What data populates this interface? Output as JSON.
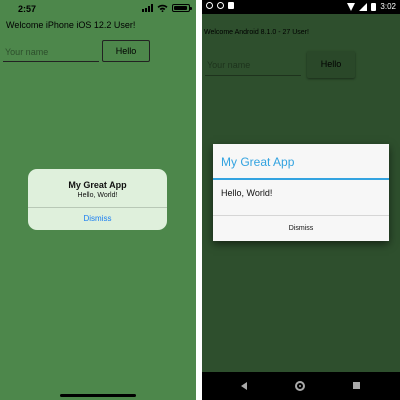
{
  "ios": {
    "status_time": "2:57",
    "welcome": "Welcome iPhone iOS 12.2 User!",
    "name_placeholder": "Your name",
    "hello_button": "Hello",
    "alert": {
      "title": "My Great App",
      "message": "Hello, World!",
      "dismiss": "Dismiss"
    },
    "colors": {
      "background": "#4d874b",
      "alert_button": "#1a7ef2"
    }
  },
  "android": {
    "status_time": "3:02",
    "welcome": "Welcome Android 8.1.0 - 27 User!",
    "name_placeholder": "Your name",
    "hello_button": "Hello",
    "dialog": {
      "title": "My Great App",
      "message": "Hello, World!",
      "dismiss": "Dismiss"
    },
    "colors": {
      "background": "#2e4f2d",
      "dialog_accent": "#33a3e0"
    },
    "nav_icons": [
      "back-icon",
      "home-icon",
      "recents-icon"
    ]
  }
}
